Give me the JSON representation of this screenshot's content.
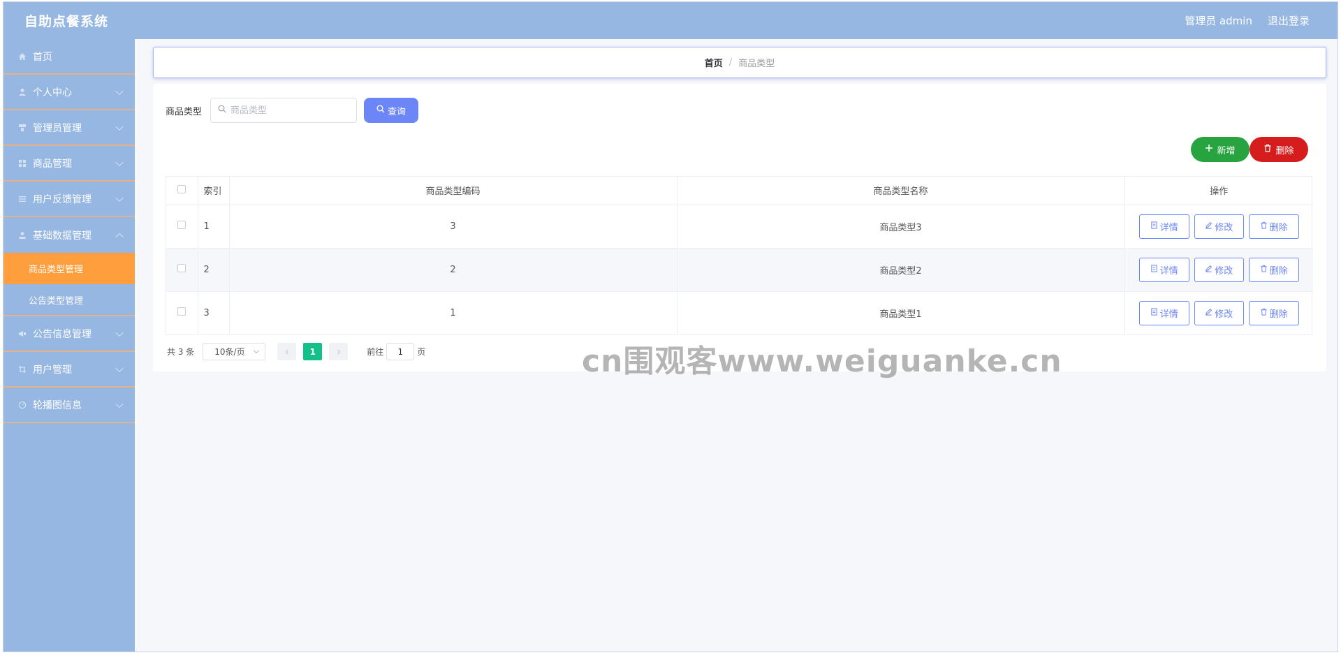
{
  "header": {
    "title": "自助点餐系统",
    "user_label": "管理员 admin",
    "logout_label": "退出登录"
  },
  "sidebar": {
    "items": [
      {
        "label": "首页",
        "icon": "home-icon",
        "has_children": false
      },
      {
        "label": "个人中心",
        "icon": "user-icon",
        "has_children": true
      },
      {
        "label": "管理员管理",
        "icon": "admin-icon",
        "has_children": true
      },
      {
        "label": "商品管理",
        "icon": "grid-icon",
        "has_children": true
      },
      {
        "label": "用户反馈管理",
        "icon": "list-icon",
        "has_children": true
      },
      {
        "label": "基础数据管理",
        "icon": "data-icon",
        "has_children": true,
        "expanded": true,
        "children": [
          {
            "label": "商品类型管理",
            "active": true
          },
          {
            "label": "公告类型管理",
            "active": false
          }
        ]
      },
      {
        "label": "公告信息管理",
        "icon": "notice-icon",
        "has_children": true
      },
      {
        "label": "用户管理",
        "icon": "crop-icon",
        "has_children": true
      },
      {
        "label": "轮播图信息",
        "icon": "carousel-icon",
        "has_children": true
      }
    ]
  },
  "breadcrumb": {
    "home": "首页",
    "separator": "/",
    "current": "商品类型"
  },
  "search": {
    "label": "商品类型",
    "placeholder": "商品类型",
    "button_label": "查询"
  },
  "actions": {
    "add_label": "新增",
    "delete_label": "删除"
  },
  "table": {
    "columns": [
      "索引",
      "商品类型编码",
      "商品类型名称",
      "操作"
    ],
    "rows": [
      {
        "index": "1",
        "code": "3",
        "name": "商品类型3"
      },
      {
        "index": "2",
        "code": "2",
        "name": "商品类型2"
      },
      {
        "index": "3",
        "code": "1",
        "name": "商品类型1"
      }
    ],
    "row_actions": {
      "detail": "详情",
      "edit": "修改",
      "delete": "删除"
    }
  },
  "pagination": {
    "total_text": "共 3 条",
    "page_size": "10条/页",
    "current_page": "1",
    "goto_label": "前往",
    "goto_value": "1",
    "page_suffix": "页"
  },
  "watermark": "cn围观客www.weiguanke.cn",
  "colors": {
    "topbar": "#96b7e2",
    "active_menu": "#ff9e3d",
    "primary": "#6d86f7",
    "add": "#27a33f",
    "delete": "#d61d1d",
    "pager_active": "#14c08a"
  }
}
